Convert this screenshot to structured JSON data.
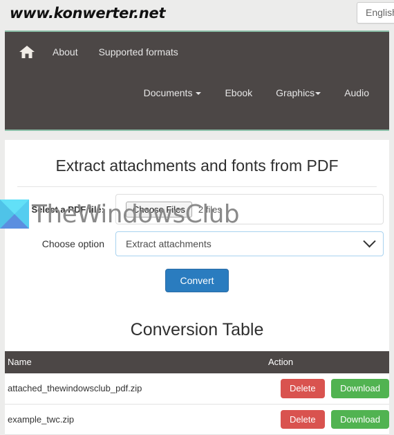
{
  "site": {
    "brand": "www.konwerter.net",
    "language_button": "English"
  },
  "nav": {
    "home_icon": "home-icon",
    "primary": [
      {
        "label": "About",
        "caret": false
      },
      {
        "label": "Supported formats",
        "caret": false
      }
    ],
    "secondary": [
      {
        "label": "Documents",
        "caret": true
      },
      {
        "label": "Ebook",
        "caret": false
      },
      {
        "label": "Graphics",
        "caret": true
      },
      {
        "label": "Audio",
        "caret": false
      }
    ]
  },
  "main": {
    "title": "Extract attachments and fonts from PDF",
    "file_row": {
      "label": "Select a PDF file:",
      "button_label": "Choose Files",
      "status": "2 files"
    },
    "option_row": {
      "label": "Choose option",
      "selected": "Extract attachments",
      "chevron_icon": "chevron-down-icon"
    },
    "convert_label": "Convert"
  },
  "table": {
    "title": "Conversion Table",
    "columns": [
      "Name",
      "Action"
    ],
    "rows": [
      {
        "name": "attached_thewindowsclub_pdf.zip",
        "delete_label": "Delete",
        "download_label": "Download"
      },
      {
        "name": "example_twc.zip",
        "delete_label": "Delete",
        "download_label": "Download"
      }
    ]
  },
  "watermark": {
    "text": "TheWindowsClub",
    "logo_icon": "thewindowsclub-logo-icon"
  },
  "colors": {
    "navbar": "#4c4746",
    "navbar_accent": "#8bbfa8",
    "primary_button": "#2a7cbf",
    "danger_button": "#d9534f",
    "success_button": "#51b351",
    "select_border": "#a8d2ef"
  }
}
